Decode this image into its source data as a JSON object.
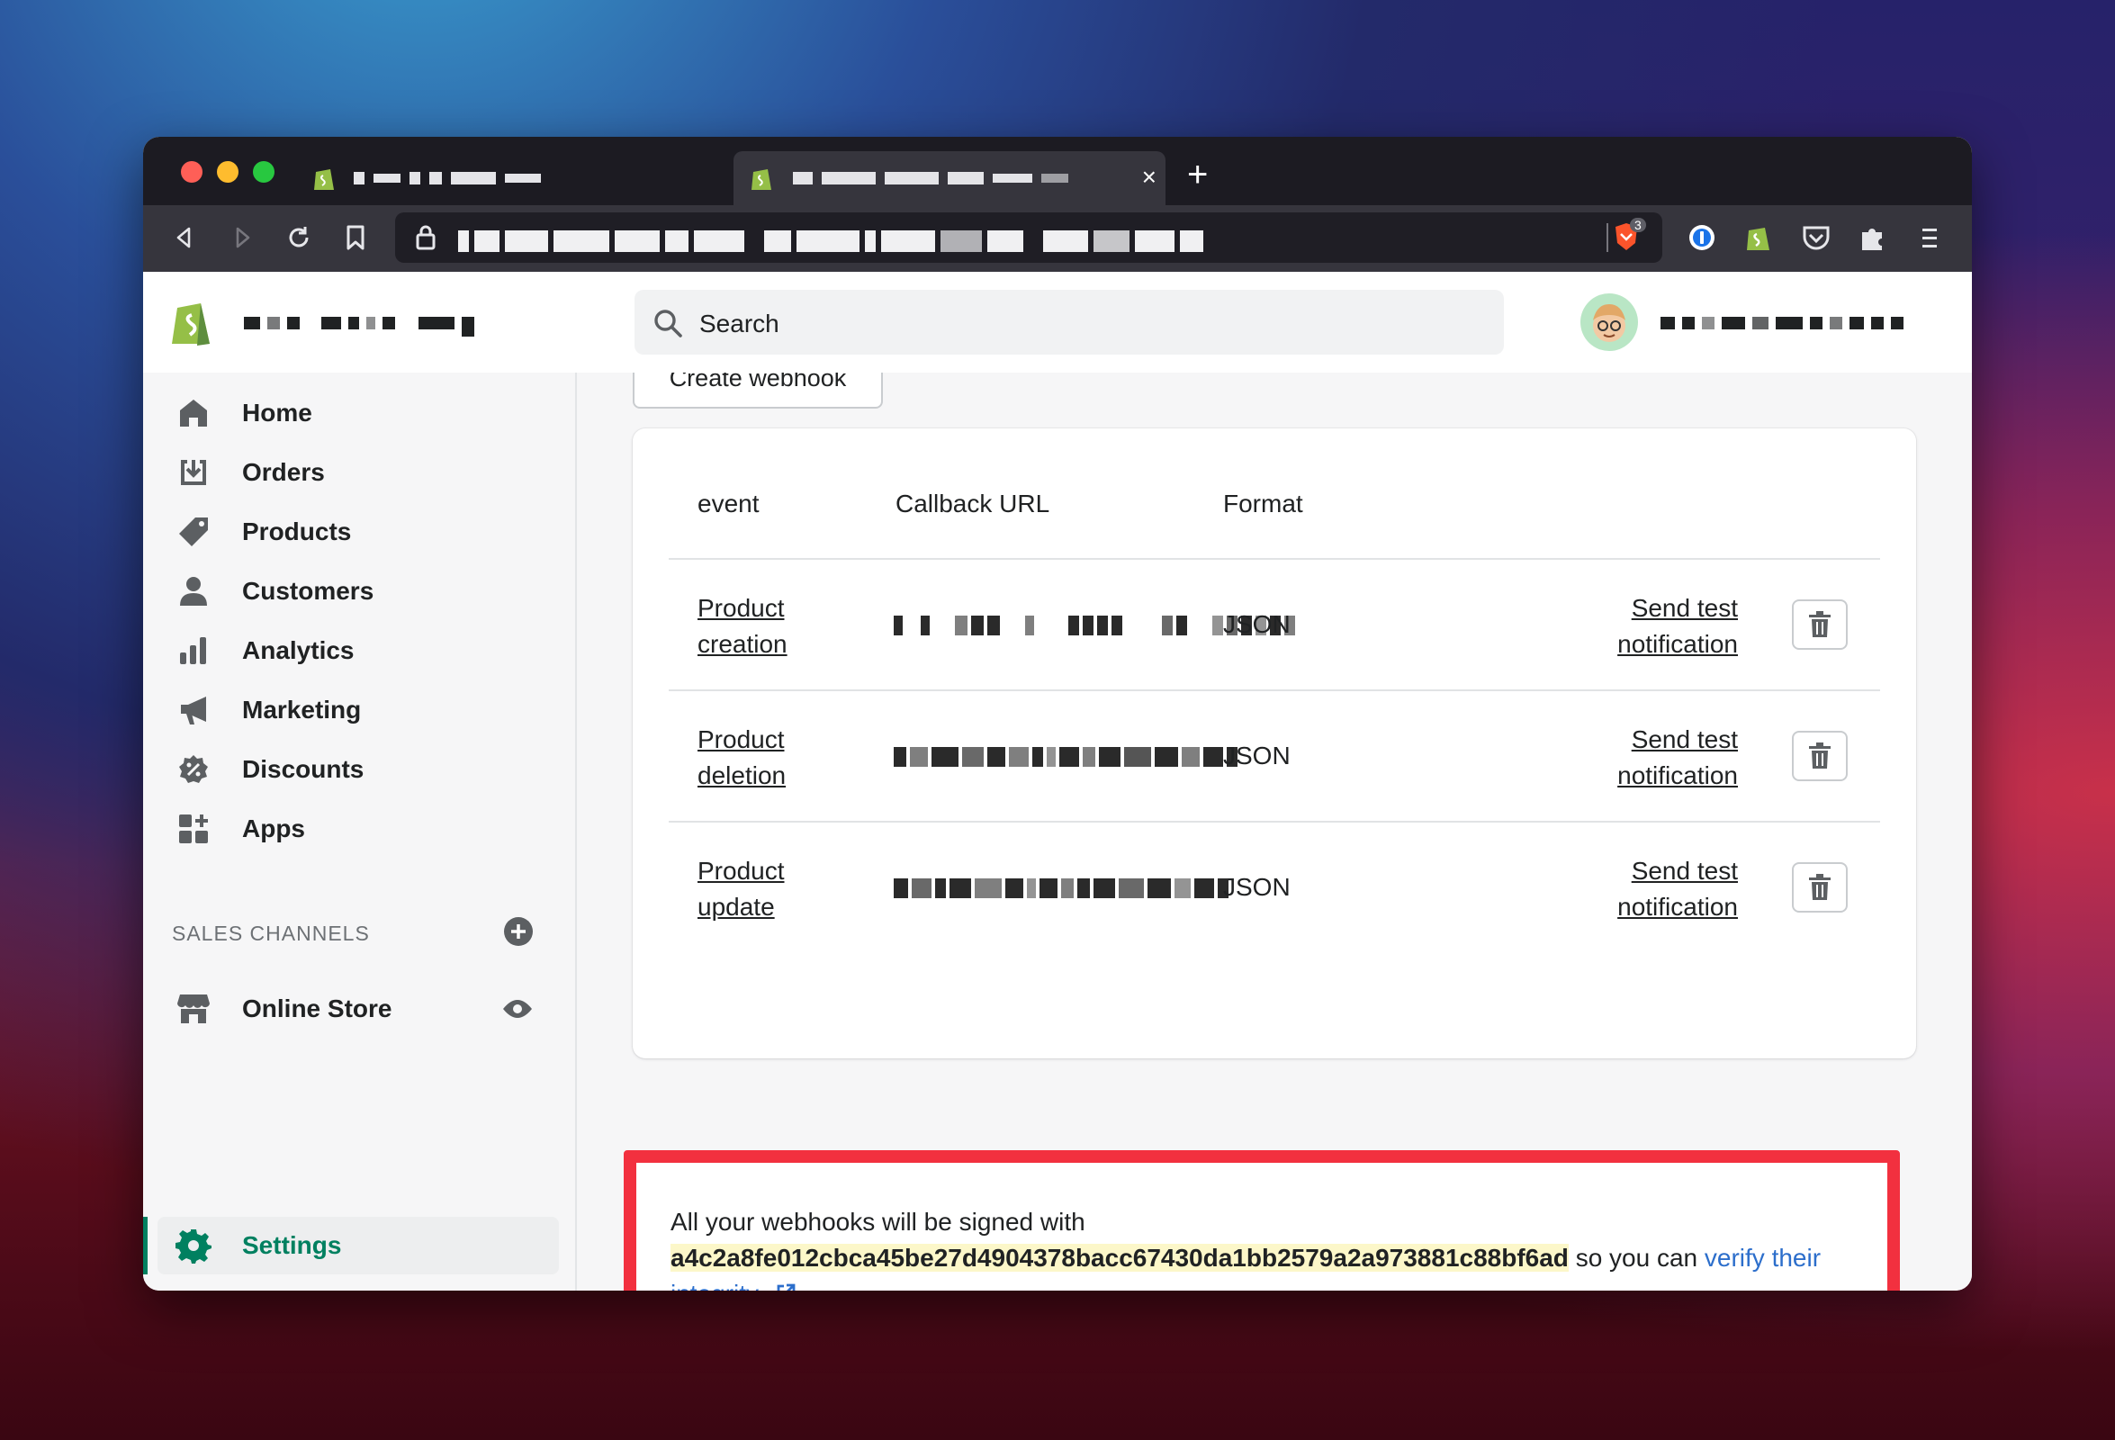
{
  "browser": {
    "new_tab_label": "+",
    "tab_close": "×",
    "brave_badge": "3"
  },
  "search": {
    "placeholder": "Search"
  },
  "sidebar": {
    "items": [
      {
        "label": "Home",
        "icon": "home-icon"
      },
      {
        "label": "Orders",
        "icon": "orders-icon"
      },
      {
        "label": "Products",
        "icon": "tag-icon"
      },
      {
        "label": "Customers",
        "icon": "person-icon"
      },
      {
        "label": "Analytics",
        "icon": "bar-chart-icon"
      },
      {
        "label": "Marketing",
        "icon": "megaphone-icon"
      },
      {
        "label": "Discounts",
        "icon": "discount-icon"
      },
      {
        "label": "Apps",
        "icon": "apps-icon"
      }
    ],
    "sales_channels_title": "SALES CHANNELS",
    "online_store_label": "Online Store",
    "settings_label": "Settings"
  },
  "main": {
    "create_button_label": "Create webhook",
    "table": {
      "headers": [
        "event",
        "Callback URL",
        "Format"
      ],
      "rows": [
        {
          "event_line1": "Product",
          "event_line2": "creation",
          "format": "JSON",
          "action_line1": "Send test",
          "action_line2": "notification"
        },
        {
          "event_line1": "Product",
          "event_line2": "deletion",
          "format": "JSON",
          "action_line1": "Send test",
          "action_line2": "notification"
        },
        {
          "event_line1": "Product",
          "event_line2": "update",
          "format": "JSON",
          "action_line1": "Send test",
          "action_line2": "notification"
        }
      ]
    },
    "notice": {
      "prefix": "All your webhooks will be signed with",
      "secret": "a4c2a8fe012cbca45be27d4904378bacc67430da1bb2579a2a973881c88bf6ad",
      "middle": "so you can",
      "link_text": "verify their integrity."
    }
  },
  "colors": {
    "accent_green": "#008060",
    "highlight_red": "#f2303f",
    "link_blue": "#2c6ecb",
    "secret_highlight": "#fcf7c9"
  }
}
